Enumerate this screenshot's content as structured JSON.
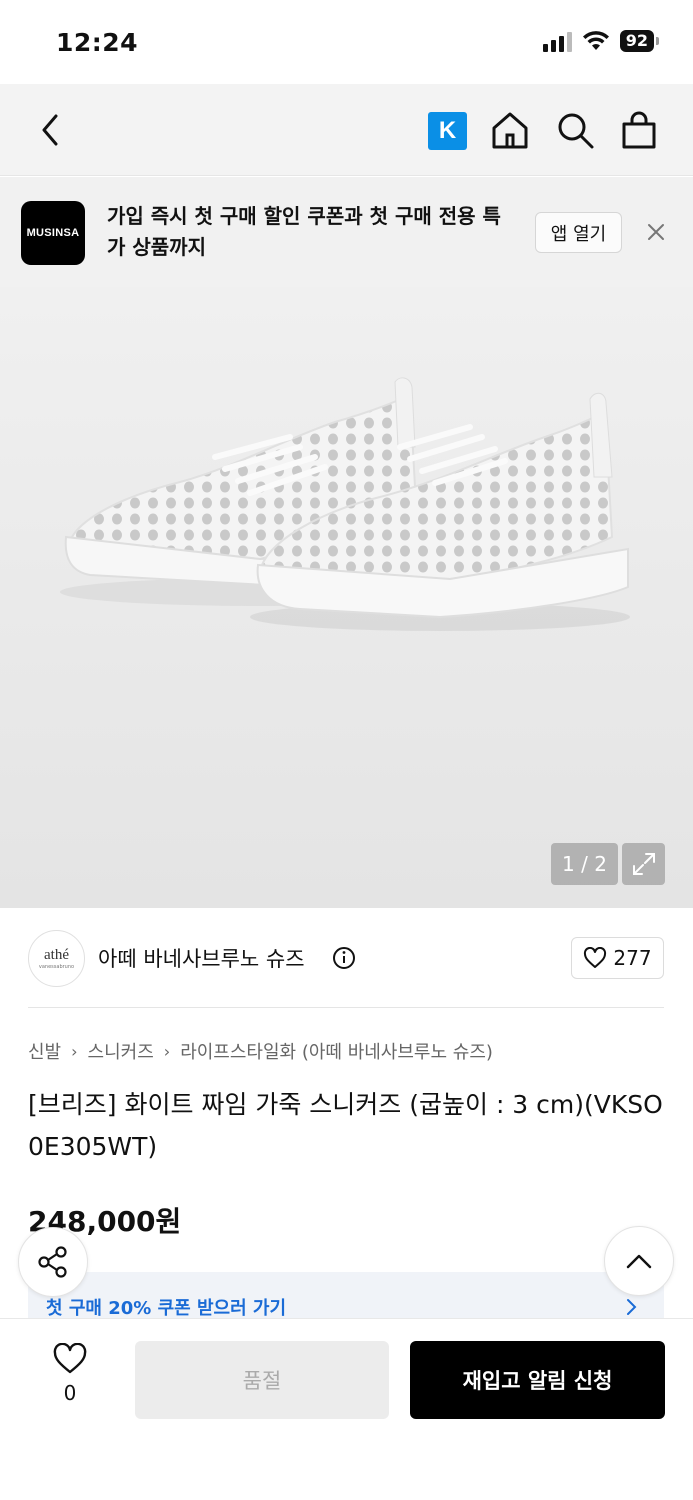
{
  "status_bar": {
    "time": "12:24",
    "battery": "92"
  },
  "nav": {
    "k_label": "K"
  },
  "banner": {
    "logo_text": "MUSINSA",
    "message": "가입 즉시 첫 구매 할인 쿠폰과 첫 구매 전용 특가 상품까지",
    "open_app_label": "앱 열기"
  },
  "image": {
    "counter": "1 / 2"
  },
  "brand": {
    "logo_text": "athé",
    "logo_subtext": "vanessabruno",
    "name": "아떼 바네사브루노 슈즈",
    "like_count": "277"
  },
  "breadcrumb": [
    "신발",
    "스니커즈",
    "라이프스타일화 (아떼 바네사브루노 슈즈)"
  ],
  "product": {
    "title": "[브리즈] 화이트 짜임 가죽 스니커즈 (굽높이 : 3 cm)(VKSO0E305WT)",
    "price": "248,000원"
  },
  "coupon": {
    "text": "첫 구매 20% 쿠폰 받으러 가기"
  },
  "bottom_bar": {
    "wish_count": "0",
    "soldout_label": "품절",
    "restock_label": "재입고 알림 신청"
  },
  "colors": {
    "accent_blue": "#1a6bd6",
    "k_badge": "#0a8fe6",
    "primary_button": "#000000"
  }
}
